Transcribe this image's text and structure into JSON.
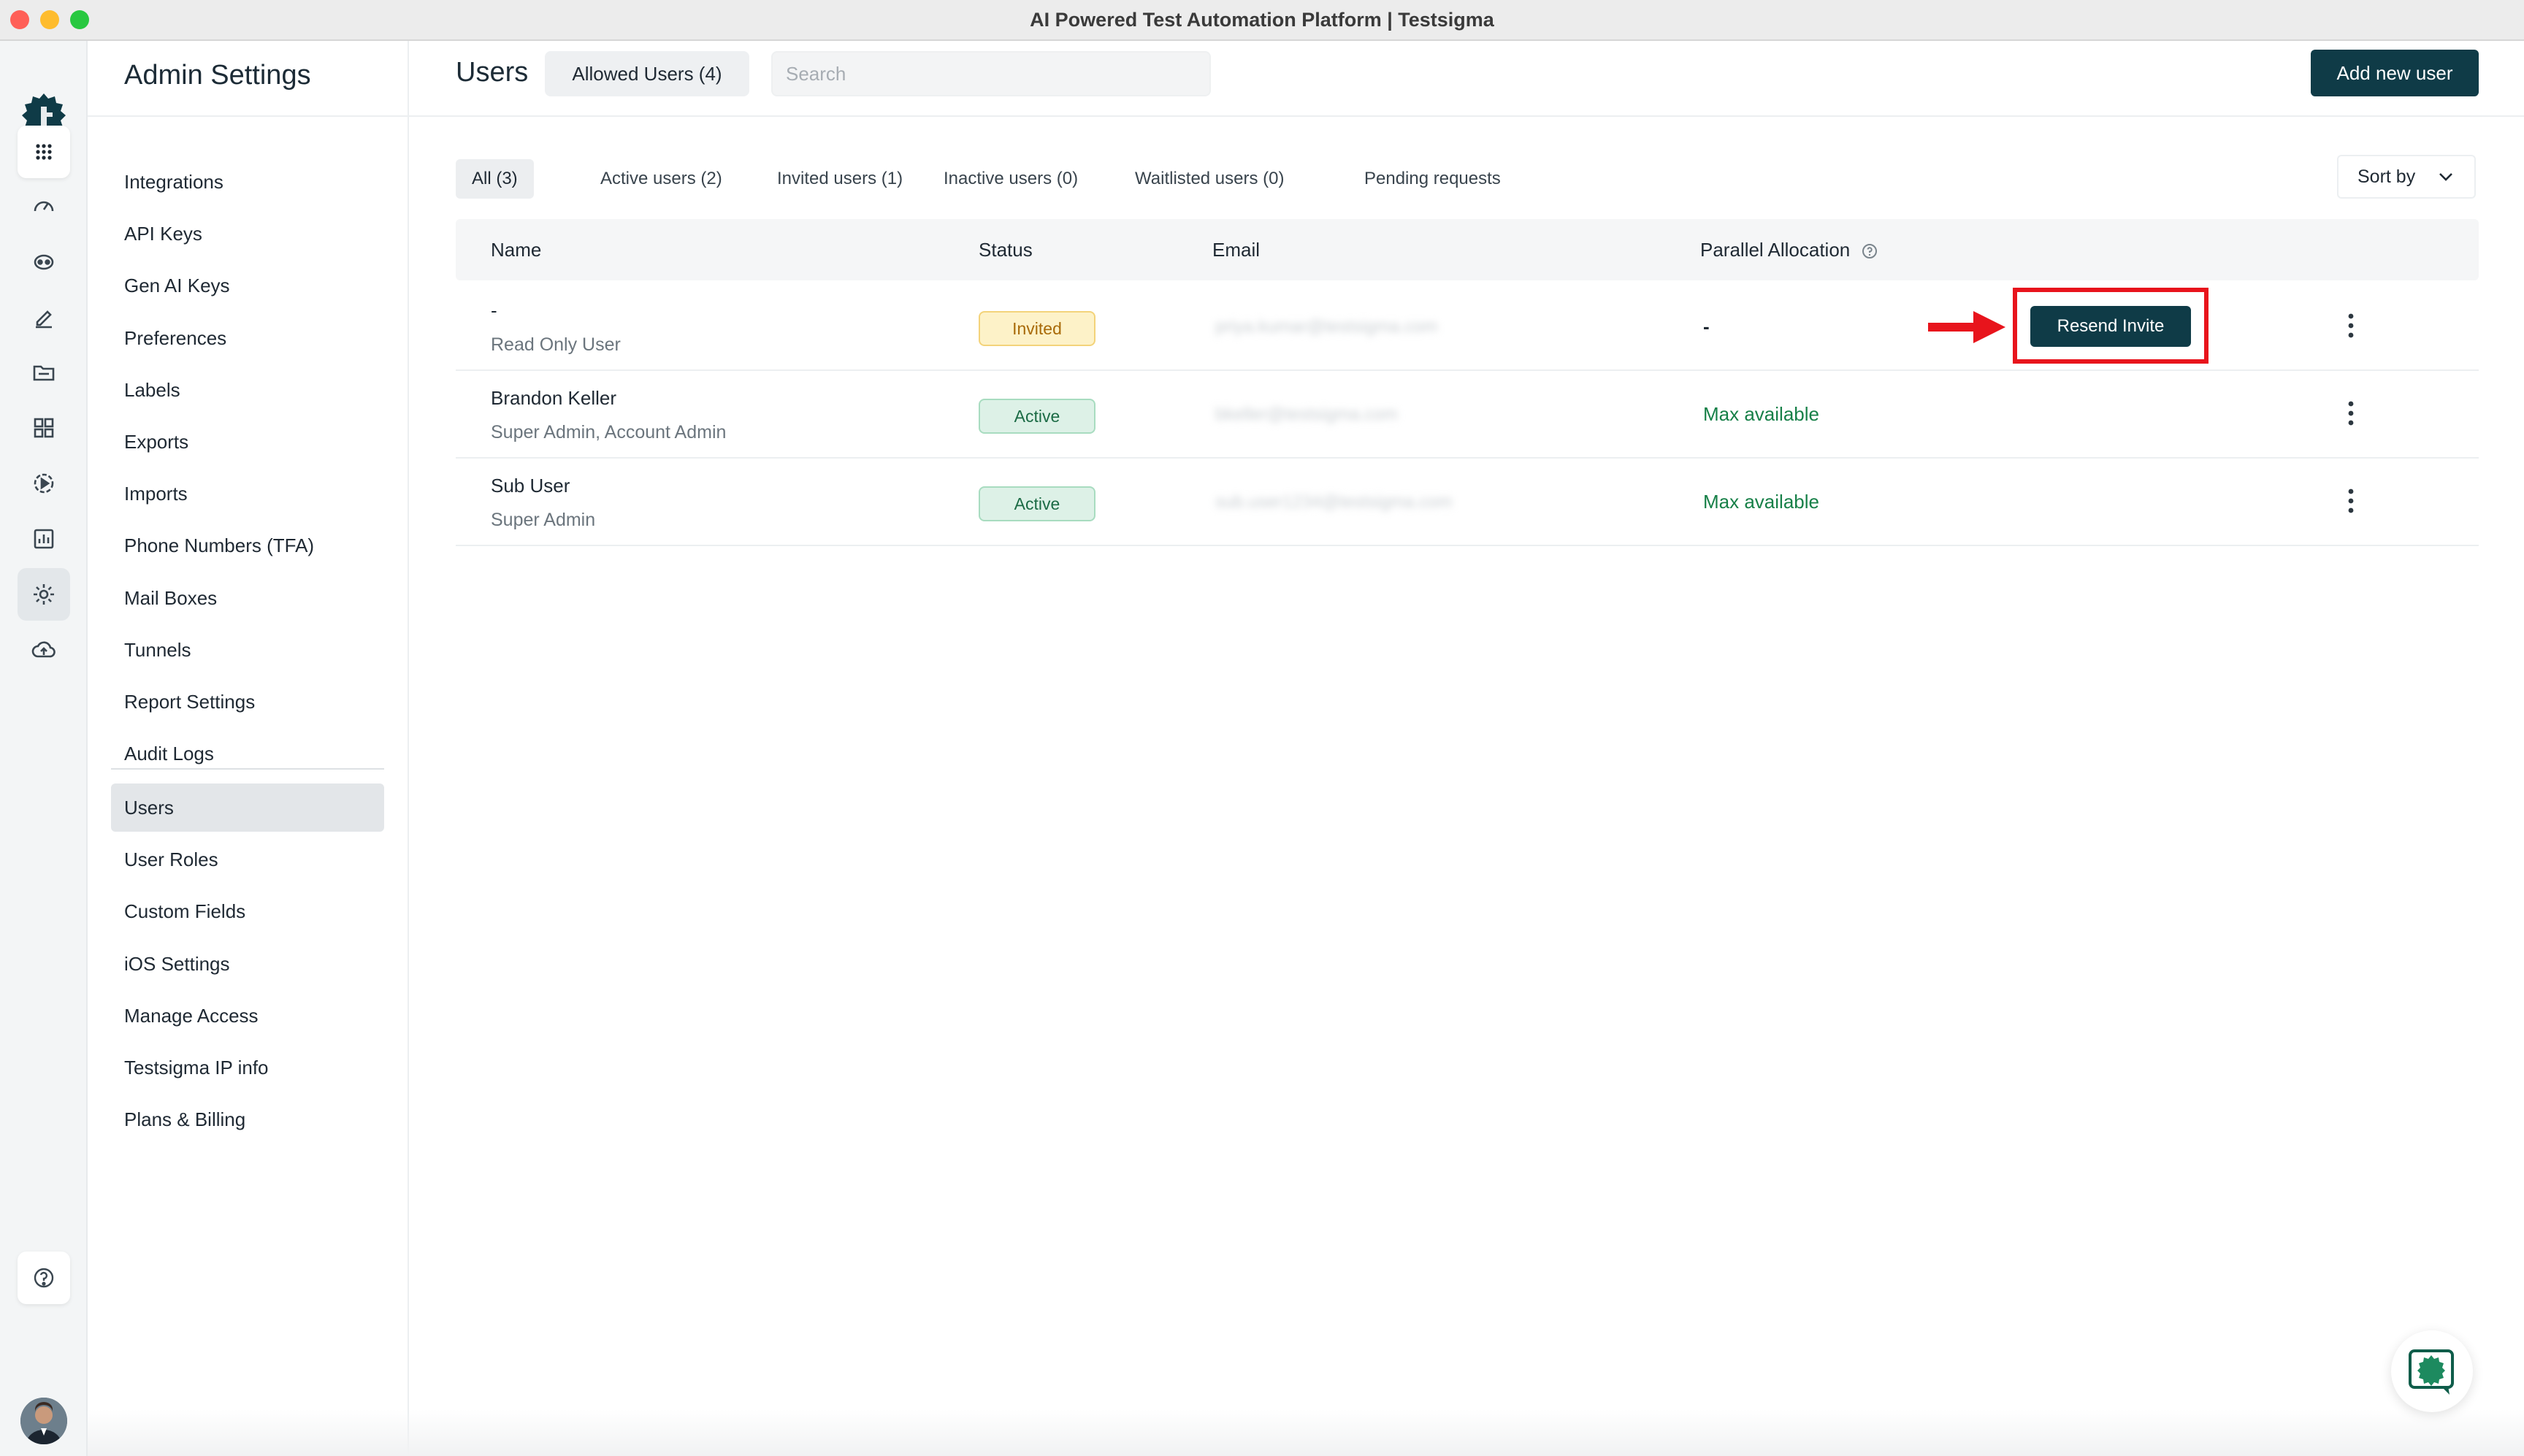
{
  "window": {
    "title": "AI Powered Test Automation Platform | Testsigma"
  },
  "rail": {
    "icons": [
      "apps-grid-icon",
      "dashboard-gauge-icon",
      "robot-agent-icon",
      "edit-pen-icon",
      "folder-icon",
      "modules-grid-icon",
      "play-run-icon",
      "reports-chart-icon",
      "gear-icon",
      "cloud-upload-icon",
      "help-icon"
    ]
  },
  "sidebar": {
    "title": "Admin Settings",
    "items": [
      "Integrations",
      "API Keys",
      "Gen AI Keys",
      "Preferences",
      "Labels",
      "Exports",
      "Imports",
      "Phone Numbers (TFA)",
      "Mail Boxes",
      "Tunnels",
      "Report Settings",
      "Audit Logs"
    ],
    "items2": [
      "Users",
      "User Roles",
      "Custom Fields",
      "iOS Settings",
      "Manage Access",
      "Testsigma IP info",
      "Plans & Billing"
    ],
    "active": "Users"
  },
  "header": {
    "title": "Users",
    "allowed_users": "Allowed Users (4)",
    "search_placeholder": "Search",
    "add_button": "Add new user"
  },
  "filters": {
    "tabs": [
      "All (3)",
      "Active users (2)",
      "Invited users (1)",
      "Inactive users (0)",
      "Waitlisted users (0)",
      "Pending requests"
    ],
    "active": "All (3)",
    "sort_label": "Sort by"
  },
  "table": {
    "columns": {
      "name": "Name",
      "status": "Status",
      "email": "Email",
      "alloc": "Parallel Allocation"
    },
    "rows": [
      {
        "name": "-",
        "role": "Read Only User",
        "status": "Invited",
        "email": "priya.kumar@testsigma.com",
        "alloc": "-",
        "action": "Resend Invite"
      },
      {
        "name": "Brandon Keller",
        "role": "Super Admin, Account Admin",
        "status": "Active",
        "email": "bkeller@testsigma.com",
        "alloc": "Max available"
      },
      {
        "name": "Sub User",
        "role": "Super Admin",
        "status": "Active",
        "email": "sub.user1234@testsigma.com",
        "alloc": "Max available"
      }
    ]
  },
  "colors": {
    "primary": "#0f3b47",
    "highlight": "#e8141c",
    "success": "#178048",
    "warning": "#a86a08"
  }
}
